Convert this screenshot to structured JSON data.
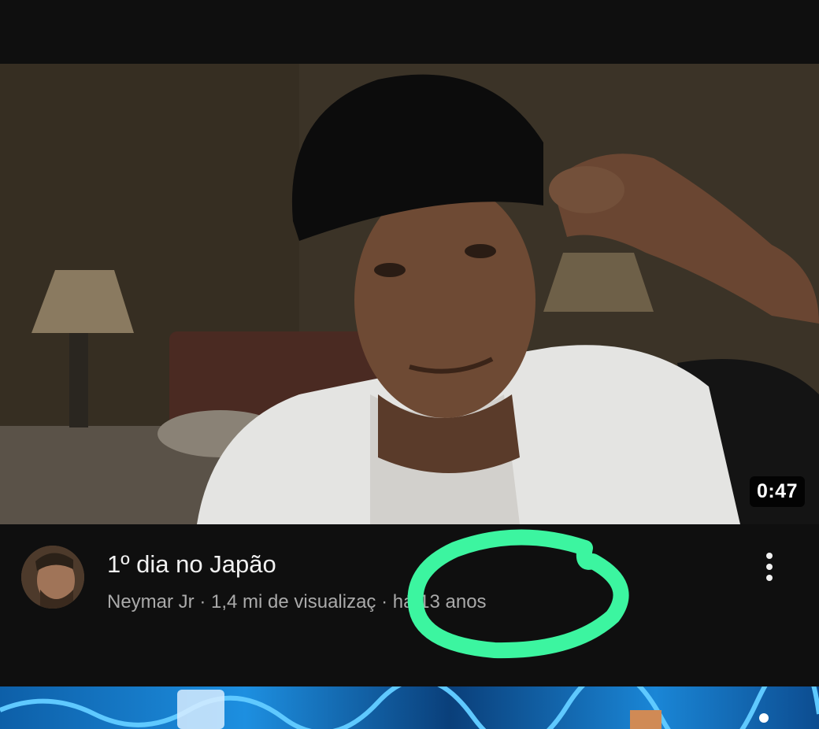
{
  "video": {
    "title": "1º dia no Japão",
    "channel": "Neymar Jr",
    "separator": " · ",
    "views": "1,4 mi de visualizaç",
    "age": "há 13 anos",
    "duration": "0:47"
  },
  "icons": {
    "more": "more-vert-icon"
  },
  "colors": {
    "background": "#0f0f0f",
    "title_text": "#f1f1f1",
    "secondary_text": "#aaaaaa",
    "highlight_marker": "#3cf5a0"
  }
}
